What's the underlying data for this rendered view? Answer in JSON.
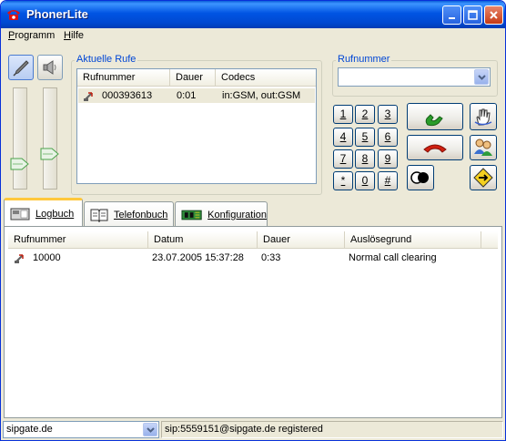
{
  "window": {
    "title": "PhonerLite"
  },
  "menu": [
    {
      "label": "Programm",
      "underline": "P",
      "rest": "rogramm"
    },
    {
      "label": "Hilfe",
      "underline": "H",
      "rest": "ilfe"
    }
  ],
  "current_calls": {
    "group_title": "Aktuelle Rufe",
    "columns": [
      "Rufnummer",
      "Dauer",
      "Codecs"
    ],
    "rows": [
      {
        "number": "000393613",
        "duration": "0:01",
        "codecs": "in:GSM, out:GSM"
      }
    ]
  },
  "number_entry": {
    "group_title": "Rufnummer",
    "value": ""
  },
  "keypad": [
    "1",
    "2",
    "3",
    "4",
    "5",
    "6",
    "7",
    "8",
    "9",
    "*",
    "0",
    "#"
  ],
  "tabs": [
    {
      "label": "Logbuch",
      "active": true,
      "icon": "logbook-icon"
    },
    {
      "label": "Telefonbuch",
      "active": false,
      "icon": "phonebook-icon"
    },
    {
      "label": "Konfiguration",
      "active": false,
      "icon": "configuration-icon"
    }
  ],
  "log": {
    "columns": [
      "Rufnummer",
      "Datum",
      "Dauer",
      "Auslösegrund"
    ],
    "rows": [
      {
        "number": "10000",
        "date": "23.07.2005 15:37:28",
        "duration": "0:33",
        "reason": "Normal call clearing"
      }
    ]
  },
  "status": {
    "account": "sipgate.de",
    "message": "sip:5559151@sipgate.de registered"
  },
  "colors": {
    "accept": "#2a9c2a",
    "hangup": "#d02010",
    "accent": "#0046d5"
  }
}
